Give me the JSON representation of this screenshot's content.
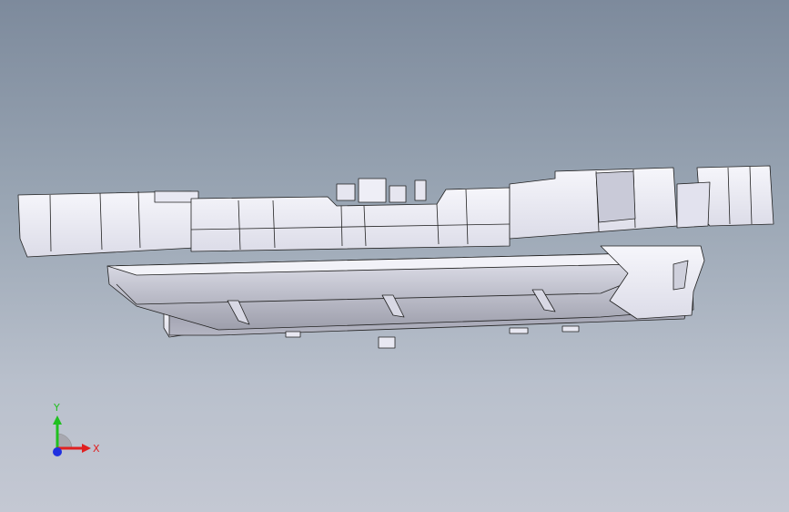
{
  "viewport": {
    "background_top": "#7d8a9c",
    "background_bottom": "#c4c8d3",
    "part_fill": "#eeeef6",
    "part_shade": "#cfd0dc",
    "part_edge": "#222222"
  },
  "triad": {
    "x_label": "X",
    "y_label": "Y",
    "x_color": "#e02020",
    "y_color": "#20c020",
    "z_color": "#2030e0"
  }
}
